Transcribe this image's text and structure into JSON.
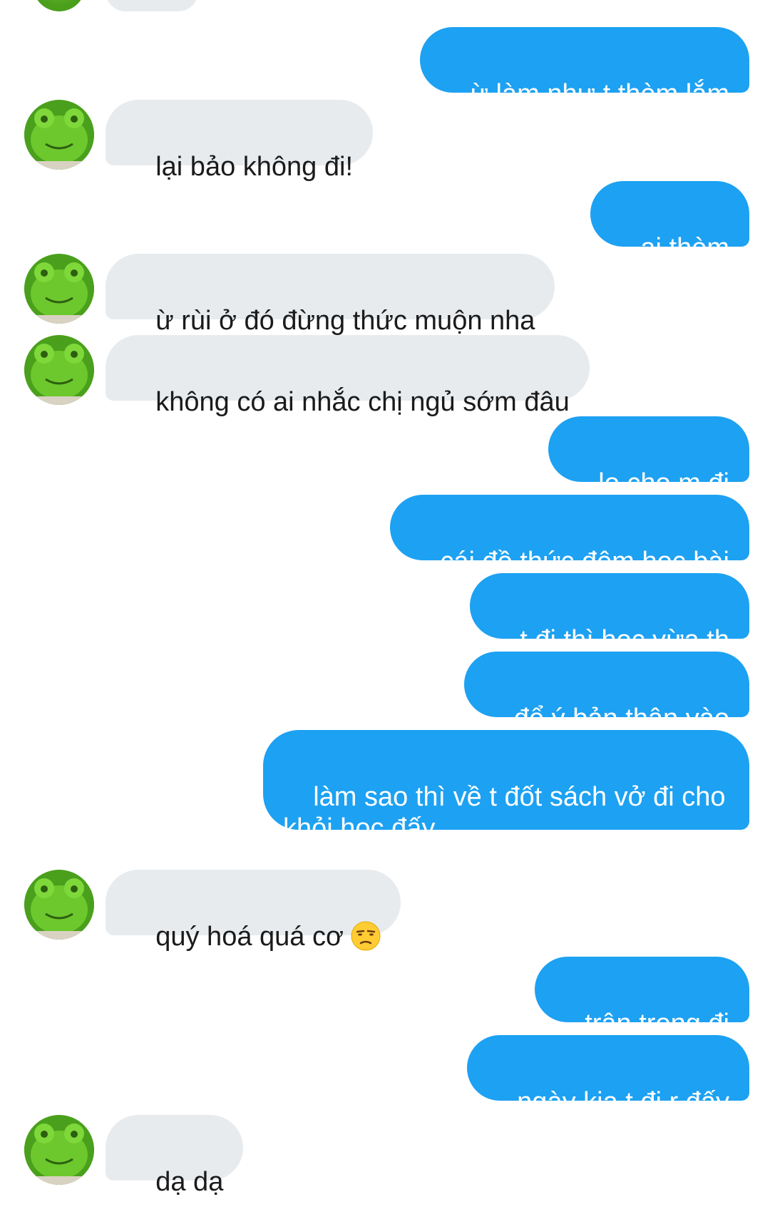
{
  "conversation": {
    "messages": [
      {
        "side": "out",
        "text": "ừ làm như t thèm lắm"
      },
      {
        "side": "in",
        "text": "lại bảo không đi!"
      },
      {
        "side": "out",
        "text": "ai thèm"
      },
      {
        "side": "in",
        "text": "ừ rùi ở đó đừng thức muộn nha"
      },
      {
        "side": "in",
        "text": "không có ai nhắc chị ngủ sớm đâu"
      },
      {
        "side": "out",
        "text": "lo cho m đi"
      },
      {
        "side": "out",
        "text": "cái đồ thức đêm học bài"
      },
      {
        "side": "out",
        "text": "t đi thì học vừa th"
      },
      {
        "side": "out",
        "text": "để ý bản thân vào"
      },
      {
        "side": "out",
        "text": "làm sao thì về t đốt sách vở đi cho khỏi học đấy"
      },
      {
        "side": "in",
        "text": "quý hoá quá cơ",
        "emoji": "unamused-face-icon"
      },
      {
        "side": "out",
        "text": "trân trọng đi"
      },
      {
        "side": "out",
        "text": "ngày kia t đi r đấy"
      },
      {
        "side": "in",
        "text": "dạ dạ"
      }
    ]
  },
  "colors": {
    "outgoing_bubble": "#1da1f2",
    "incoming_bubble": "#e8ebee",
    "outgoing_text": "#ffffff",
    "incoming_text": "#1b1b1b",
    "avatar_green": "#5fbf25"
  },
  "icons": {
    "avatar": "green-frog-plush-avatar",
    "emoji": "unamused-face-icon"
  }
}
